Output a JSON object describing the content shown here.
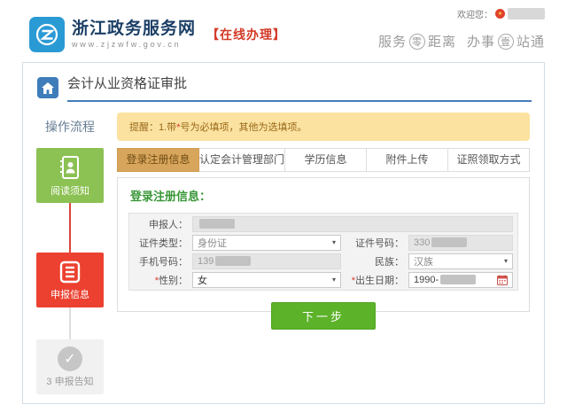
{
  "icons": {
    "dropdown_arrow": "▾",
    "check_mark": "✓",
    "star": "★"
  },
  "header": {
    "site_name": "浙江政务服务网",
    "site_url": "www.zjzwfw.gov.cn",
    "mode_label": "【在线办理】",
    "welcome_label": "欢迎您：",
    "slogan_part1": "服务",
    "slogan_circle1": "零",
    "slogan_part2": "距离",
    "slogan_part3": "办事",
    "slogan_circle2": "壹",
    "slogan_part4": "站通"
  },
  "page": {
    "title": "会计从业资格证审批"
  },
  "flow": {
    "title": "操作流程",
    "steps": [
      {
        "label": "阅读须知"
      },
      {
        "label": "申报信息"
      },
      {
        "label": "3 申报告知"
      }
    ]
  },
  "notice": {
    "part1": "提醒：1.带",
    "star": "*",
    "part2": "号为必填项，其他为选填项。"
  },
  "tabs": [
    {
      "label": "登录注册信息"
    },
    {
      "label": "认定会计管理部门"
    },
    {
      "label": "学历信息"
    },
    {
      "label": "附件上传"
    },
    {
      "label": "证照领取方式"
    }
  ],
  "form": {
    "section_title": "登录注册信息：",
    "required_mark": "*",
    "applicant_label": "申报人：",
    "id_type_label": "证件类型：",
    "id_type_value": "身份证",
    "id_number_label": "证件号码：",
    "id_number_prefix": "330",
    "phone_label": "手机号码：",
    "phone_prefix": "139",
    "ethnicity_label": "民族：",
    "ethnicity_value": "汉族",
    "gender_label": "性别：",
    "gender_value": "女",
    "birth_label": "出生日期：",
    "birth_prefix": "1990-",
    "next_button": "下一步"
  }
}
